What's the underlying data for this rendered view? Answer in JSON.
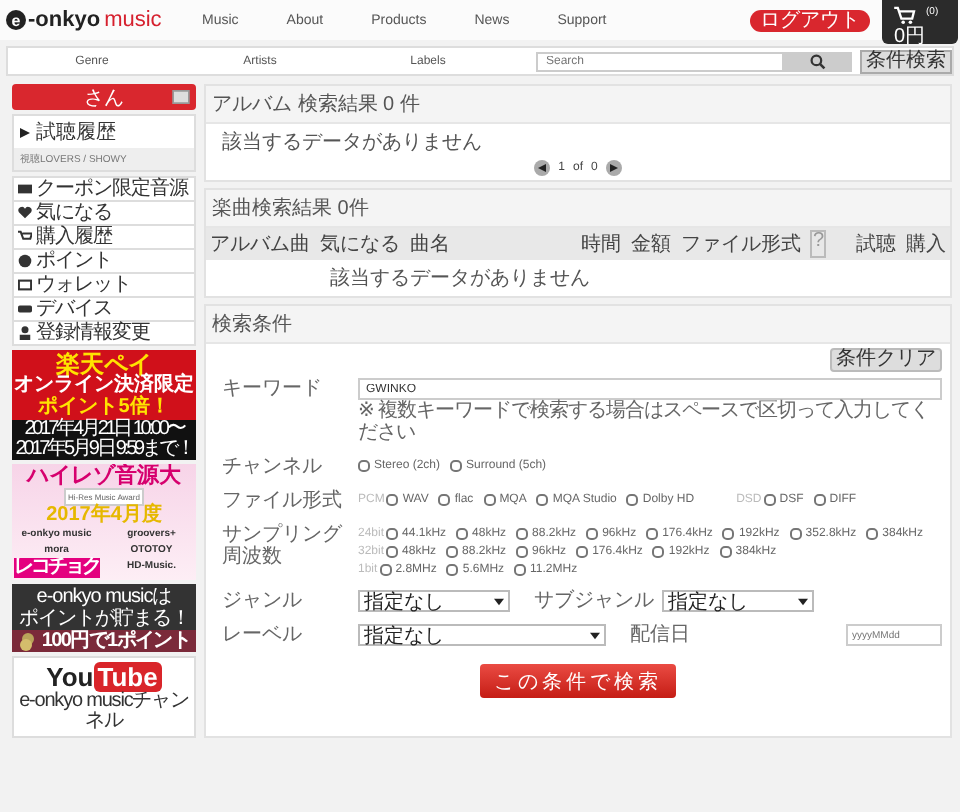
{
  "header": {
    "logo": {
      "mark": "e",
      "name": "-onkyo",
      "suffix": "music"
    },
    "nav": [
      "Music",
      "About",
      "Products",
      "News",
      "Support"
    ],
    "logout": "ログアウト",
    "cart": {
      "count": "(0)",
      "total": "0円"
    }
  },
  "subnav": {
    "items": [
      "Genre",
      "Artists",
      "Labels"
    ],
    "search": {
      "placeholder": "Search"
    },
    "advanced_button": "条件検索"
  },
  "sidebar": {
    "user": "さん",
    "history": {
      "title": "試聴履歴",
      "item": "視聴LOVERS / SHOWY"
    },
    "menu": [
      "クーポン限定音源",
      "気になる",
      "購入履歴",
      "ポイント",
      "ウォレット",
      "デバイス",
      "登録情報変更"
    ],
    "banners": [
      {
        "kind": "rakuten",
        "lines": [
          "楽天ペイ",
          "オンライン決済限定",
          "ポイント5倍！",
          "2017年4月21日 10:00〜",
          "2017年5月9日 9:59まで！"
        ]
      },
      {
        "kind": "hires",
        "lines": [
          "ハイレゾ音源大",
          "Hi-Res Music Award",
          "2017年4月度"
        ],
        "logos": [
          "e-onkyo music",
          "groovers+",
          "mora",
          "OTOTOY",
          "レコチョク",
          "HD-Music."
        ]
      },
      {
        "kind": "points",
        "lines": [
          "e-onkyo musicは",
          "ポイントが貯まる！",
          "100円で1ポイント"
        ]
      },
      {
        "kind": "youtube",
        "lines": [
          "You",
          "Tube",
          "e-onkyo musicチャンネル"
        ]
      }
    ]
  },
  "album_results": {
    "title": "アルバム 検索結果 0 件",
    "empty": "該当するデータがありません",
    "pager": {
      "page": "1",
      "of": "of",
      "total": "0"
    }
  },
  "track_results": {
    "title": "楽曲検索結果 0件",
    "columns": [
      "アルバム曲",
      "気になる",
      "曲名",
      "時間",
      "金額",
      "ファイル形式",
      "?",
      "試聴",
      "購入"
    ],
    "empty": "該当するデータがありません"
  },
  "conditions": {
    "title": "検索条件",
    "clear_button": "条件クリア",
    "keyword": {
      "label": "キーワード",
      "value": "GWINKO",
      "hint": "※ 複数キーワードで検索する場合はスペースで区切って入力してください"
    },
    "channel": {
      "label": "チャンネル",
      "options": [
        {
          "label": "Stereo (2ch)",
          "checked": false
        },
        {
          "label": "Surround (5ch)",
          "checked": false
        }
      ]
    },
    "file_format": {
      "label": "ファイル形式",
      "groups": [
        {
          "name": "PCM",
          "options": [
            {
              "label": "WAV",
              "checked": false
            },
            {
              "label": "flac",
              "checked": false
            },
            {
              "label": "MQA",
              "checked": false
            },
            {
              "label": "MQA Studio",
              "checked": false
            },
            {
              "label": "Dolby HD",
              "checked": false
            }
          ]
        },
        {
          "name": "DSD",
          "options": [
            {
              "label": "DSF",
              "checked": false
            },
            {
              "label": "DIFF",
              "checked": false
            }
          ]
        }
      ]
    },
    "sampling": {
      "label": "サンプリング周波数",
      "groups": [
        {
          "name": "24bit",
          "options": [
            {
              "label": "44.1kHz",
              "checked": false
            },
            {
              "label": "48kHz",
              "checked": false
            },
            {
              "label": "88.2kHz",
              "checked": false
            },
            {
              "label": "96kHz",
              "checked": false
            },
            {
              "label": "176.4kHz",
              "checked": false
            },
            {
              "label": "192kHz",
              "checked": false
            },
            {
              "label": "352.8kHz",
              "checked": false
            },
            {
              "label": "384kHz",
              "checked": false
            }
          ]
        },
        {
          "name": "32bit",
          "options": [
            {
              "label": "48kHz",
              "checked": false
            },
            {
              "label": "88.2kHz",
              "checked": false
            },
            {
              "label": "96kHz",
              "checked": false
            },
            {
              "label": "176.4kHz",
              "checked": false
            },
            {
              "label": "192kHz",
              "checked": false
            },
            {
              "label": "384kHz",
              "checked": false
            }
          ]
        },
        {
          "name": "1bit",
          "options": [
            {
              "label": "2.8MHz",
              "checked": false
            },
            {
              "label": "5.6MHz",
              "checked": false
            },
            {
              "label": "11.2MHz",
              "checked": false
            }
          ]
        }
      ]
    },
    "genre": {
      "label": "ジャンル",
      "value": "指定なし"
    },
    "subgenre": {
      "label": "サブジャンル",
      "value": "指定なし"
    },
    "label": {
      "label": "レーベル",
      "value": "指定なし"
    },
    "release_date": {
      "label": "配信日",
      "placeholder": "yyyyMMdd"
    },
    "submit": "この条件で検索"
  }
}
